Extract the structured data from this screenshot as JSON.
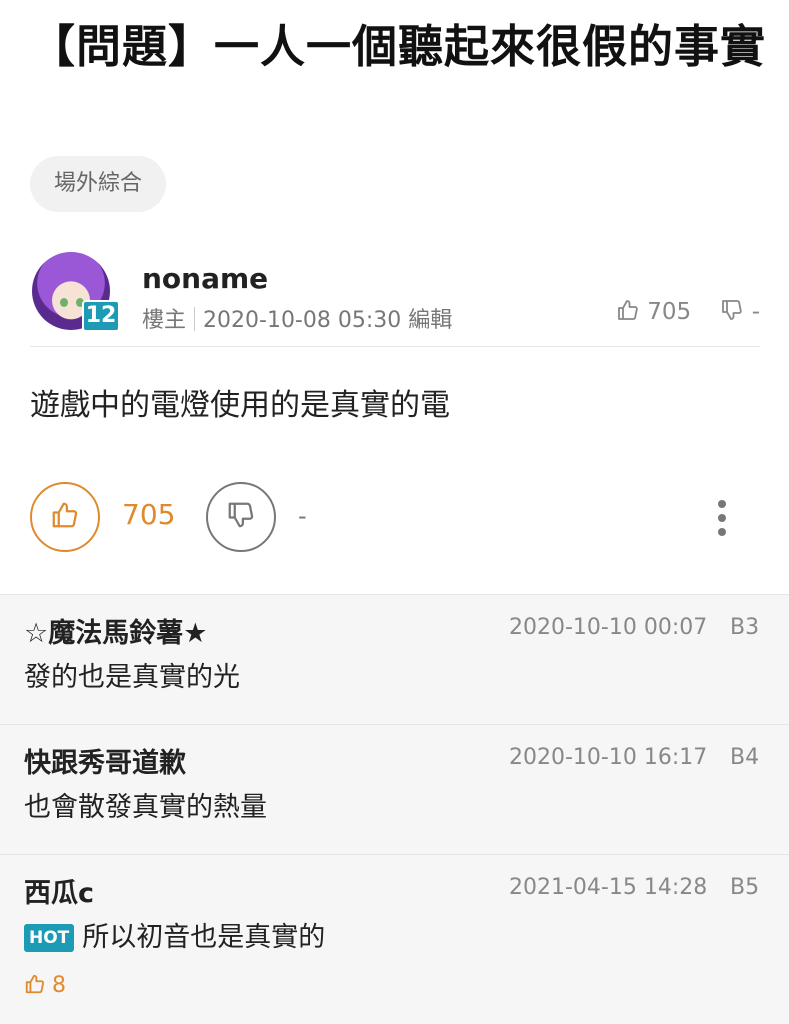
{
  "post": {
    "title": "【問題】一人一個聽起來很假的事實",
    "board": "場外綜合",
    "author": {
      "name": "noname",
      "level": "12",
      "role": "樓主",
      "datetime": "2020-10-08 05:30",
      "edit_label": "編輯",
      "likes": "705",
      "dislikes": "-"
    },
    "body": "遊戲中的電燈使用的是真實的電",
    "actions": {
      "like_count": "705",
      "dislike_count": "-"
    }
  },
  "replies": [
    {
      "name": "☆魔法馬鈴薯★",
      "time": "2020-10-10 00:07",
      "floor": "B3",
      "text": "發的也是真實的光"
    },
    {
      "name": "快跟秀哥道歉",
      "time": "2020-10-10 16:17",
      "floor": "B4",
      "text": "也會散發真實的熱量"
    },
    {
      "name": "西瓜c",
      "time": "2021-04-15 14:28",
      "floor": "B5",
      "badge": "HOT",
      "text": "所以初音也是真實的",
      "likes": "8"
    }
  ],
  "colors": {
    "accent": "#e08a2e",
    "badge": "#1d9bb4",
    "muted": "#888888"
  },
  "icons": [
    "thumbs-up-icon",
    "thumbs-down-icon",
    "more-vertical-icon"
  ]
}
